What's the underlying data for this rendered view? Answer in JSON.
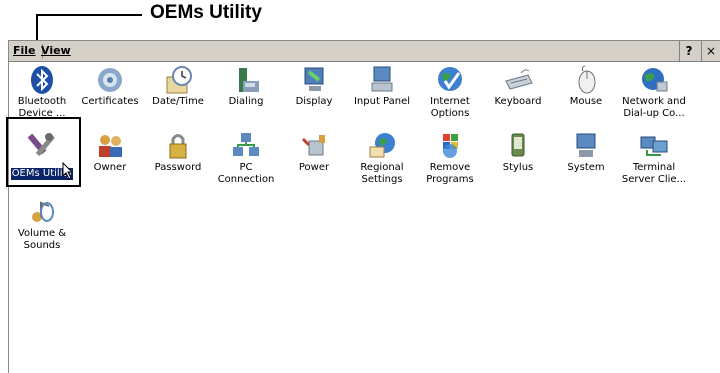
{
  "callout": {
    "title": "OEMs Utility"
  },
  "menubar": {
    "file_label": "File",
    "view_label": "View",
    "help_label": "?",
    "close_label": "×"
  },
  "items": [
    {
      "label": "Bluetooth\nDevice ...",
      "icon": "bluetooth-icon"
    },
    {
      "label": "Certificates",
      "icon": "certificates-icon"
    },
    {
      "label": "Date/Time",
      "icon": "clock-icon"
    },
    {
      "label": "Dialing",
      "icon": "phone-icon"
    },
    {
      "label": "Display",
      "icon": "display-icon"
    },
    {
      "label": "Input Panel",
      "icon": "input-panel-icon"
    },
    {
      "label": "Internet\nOptions",
      "icon": "globe-icon"
    },
    {
      "label": "Keyboard",
      "icon": "keyboard-icon"
    },
    {
      "label": "Mouse",
      "icon": "mouse-icon"
    },
    {
      "label": "Network and\nDial-up Co...",
      "icon": "network-icon"
    },
    {
      "label": "OEMs Utility",
      "icon": "tools-icon"
    },
    {
      "label": "Owner",
      "icon": "owner-icon"
    },
    {
      "label": "Password",
      "icon": "lock-icon"
    },
    {
      "label": "PC\nConnection",
      "icon": "pc-connection-icon"
    },
    {
      "label": "Power",
      "icon": "power-icon"
    },
    {
      "label": "Regional\nSettings",
      "icon": "regional-globe-icon"
    },
    {
      "label": "Remove\nPrograms",
      "icon": "remove-programs-icon"
    },
    {
      "label": "Stylus",
      "icon": "stylus-icon"
    },
    {
      "label": "System",
      "icon": "system-icon"
    },
    {
      "label": "Terminal\nServer Clie...",
      "icon": "terminal-server-icon"
    },
    {
      "label": "Volume &\nSounds",
      "icon": "speaker-icon"
    }
  ]
}
